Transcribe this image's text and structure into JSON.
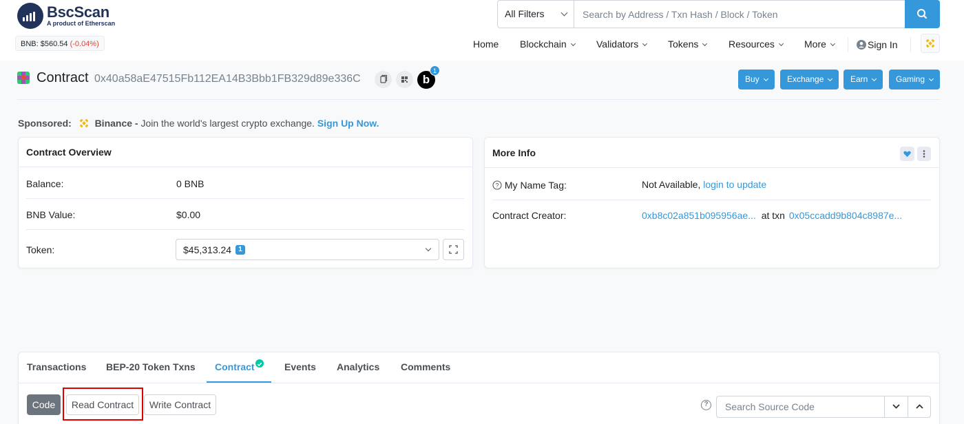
{
  "header": {
    "logo_name": "BscScan",
    "logo_sub": "A product of Etherscan",
    "price_label": "BNB: $560.54",
    "price_change": "(-0.04%)",
    "filter_label": "All Filters",
    "search_placeholder": "Search by Address / Txn Hash / Block / Token",
    "nav": {
      "home": "Home",
      "blockchain": "Blockchain",
      "validators": "Validators",
      "tokens": "Tokens",
      "resources": "Resources",
      "more": "More",
      "signin": "Sign In"
    }
  },
  "title": {
    "label": "Contract",
    "address": "0x40a58aE47515Fb112EA14B3Bbb1FB329d89e336C",
    "b_letter": "b",
    "b_badge": "1",
    "buttons": {
      "buy": "Buy",
      "exchange": "Exchange",
      "earn": "Earn",
      "gaming": "Gaming"
    }
  },
  "sponsored": {
    "label": "Sponsored:",
    "brand": "Binance -",
    "text": "Join the world's largest crypto exchange.",
    "cta": "Sign Up Now."
  },
  "overview": {
    "title": "Contract Overview",
    "balance_label": "Balance:",
    "balance_value": "0 BNB",
    "value_label": "BNB Value:",
    "value_value": "$0.00",
    "token_label": "Token:",
    "token_value": "$45,313.24",
    "token_count": "1"
  },
  "more_info": {
    "title": "More Info",
    "name_tag_label": "My Name Tag:",
    "name_tag_value": "Not Available,",
    "name_tag_link": "login to update",
    "creator_label": "Contract Creator:",
    "creator_address": "0xb8c02a851b095956ae...",
    "at_txn": "at txn",
    "creator_txn": "0x05ccadd9b804c8987e..."
  },
  "tabs": {
    "transactions": "Transactions",
    "bep20": "BEP-20 Token Txns",
    "contract": "Contract",
    "events": "Events",
    "analytics": "Analytics",
    "comments": "Comments"
  },
  "contract_panel": {
    "code": "Code",
    "read": "Read Contract",
    "write": "Write Contract",
    "help": "?",
    "search_placeholder": "Search Source Code"
  },
  "colors": {
    "accent": "#3498db",
    "negative": "#de4437",
    "verified": "#00c9a7",
    "highlight_box": "#e00000",
    "binance": "#f0b90b"
  }
}
